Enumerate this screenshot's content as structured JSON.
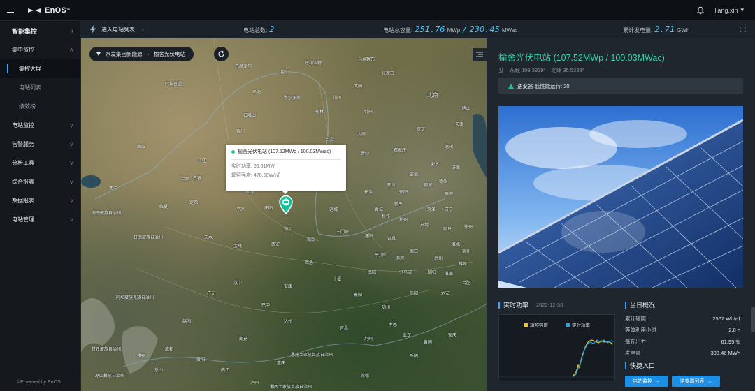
{
  "app": {
    "brand": "EnOS",
    "user": "liang.xin",
    "user_caret": "▾"
  },
  "sidebar": {
    "items": [
      {
        "label": "智能集控",
        "type": "top",
        "chevron": "›"
      },
      {
        "label": "集中监控",
        "type": "group",
        "chevron": "˄"
      },
      {
        "label": "集控大屏",
        "type": "sub-active",
        "chevron": ""
      },
      {
        "label": "电站列表",
        "type": "sub",
        "chevron": ""
      },
      {
        "label": "绩效榜",
        "type": "sub",
        "chevron": ""
      },
      {
        "label": "电站监控",
        "type": "group",
        "chevron": "˅"
      },
      {
        "label": "告警服务",
        "type": "group",
        "chevron": "˅"
      },
      {
        "label": "分析工具",
        "type": "group",
        "chevron": "˅"
      },
      {
        "label": "综合报表",
        "type": "group",
        "chevron": "˅"
      },
      {
        "label": "数据报表",
        "type": "group",
        "chevron": "˅"
      },
      {
        "label": "电站管理",
        "type": "group",
        "chevron": "˅"
      }
    ],
    "powered_by": "©Powered by EnOS"
  },
  "statbar": {
    "enter_label": "进入电站列表",
    "enter_chevron": "›",
    "total_stations_label": "电站总数:",
    "total_stations_value": "2",
    "capacity_label": "电站总容量:",
    "capacity_mwp_value": "251.76",
    "capacity_mwp_unit": "MWp",
    "capacity_sep": "/",
    "capacity_mwac_value": "230.45",
    "capacity_mwac_unit": "MWac",
    "cumulative_label": "累计发电量:",
    "cumulative_value": "2.71",
    "cumulative_unit": "GWh"
  },
  "map": {
    "breadcrumb": {
      "root": "水发集团新能源",
      "separator": "›",
      "current": "榆舍光伏电站"
    },
    "popup": {
      "title": "榆舍光伏电站 (107.52MWp / 100.03MWac)",
      "power_label": "实时功率:",
      "power_value": "66.61MW",
      "irradiance_label": "辐照强度:",
      "irradiance_value": "478.58W/㎡"
    },
    "labels": [
      {
        "t": "巴彦淖尔",
        "c": "ml1"
      },
      {
        "t": "包头",
        "c": "ml2"
      },
      {
        "t": "呼和浩特",
        "c": "ml3"
      },
      {
        "t": "乌兰察布",
        "c": "ml4"
      },
      {
        "t": "张家口",
        "c": "ml5"
      },
      {
        "t": "北京",
        "c": "ml6 big"
      },
      {
        "t": "天津",
        "c": "ml7"
      },
      {
        "t": "唐山",
        "c": "ml8"
      },
      {
        "t": "鄂尔多斯",
        "c": "ml9"
      },
      {
        "t": "乌海",
        "c": "ml10"
      },
      {
        "t": "阿拉善盟",
        "c": "ml11"
      },
      {
        "t": "大同",
        "c": "ml12"
      },
      {
        "t": "朔州",
        "c": "ml13"
      },
      {
        "t": "忻州",
        "c": "ml14"
      },
      {
        "t": "石家庄",
        "c": "ml15"
      },
      {
        "t": "保定",
        "c": "ml16"
      },
      {
        "t": "沧州",
        "c": "ml17"
      },
      {
        "t": "太原",
        "c": "ml18"
      },
      {
        "t": "邢台",
        "c": "ml19"
      },
      {
        "t": "吕梁",
        "c": "ml20"
      },
      {
        "t": "晋中",
        "c": "ml21"
      },
      {
        "t": "长治",
        "c": "ml22"
      },
      {
        "t": "济南",
        "c": "ml23"
      },
      {
        "t": "聊城",
        "c": "ml24"
      },
      {
        "t": "西宁",
        "c": "ml25"
      },
      {
        "t": "兰州",
        "c": "ml26"
      },
      {
        "t": "固原",
        "c": "ml27"
      },
      {
        "t": "平凉",
        "c": "ml28"
      },
      {
        "t": "庆阳",
        "c": "ml29"
      },
      {
        "t": "延安",
        "c": "ml30"
      },
      {
        "t": "铜川",
        "c": "ml31"
      },
      {
        "t": "渭南",
        "c": "ml32"
      },
      {
        "t": "西安",
        "c": "ml33"
      },
      {
        "t": "宝鸡",
        "c": "ml34"
      },
      {
        "t": "天水",
        "c": "ml35"
      },
      {
        "t": "三门峡",
        "c": "ml36"
      },
      {
        "t": "洛阳",
        "c": "ml37"
      },
      {
        "t": "郑州",
        "c": "ml38"
      },
      {
        "t": "开封",
        "c": "ml39"
      },
      {
        "t": "商丘",
        "c": "ml40"
      },
      {
        "t": "徐州",
        "c": "ml41"
      },
      {
        "t": "平顶山",
        "c": "ml42"
      },
      {
        "t": "周口",
        "c": "ml43"
      },
      {
        "t": "南阳",
        "c": "ml44"
      },
      {
        "t": "驻马店",
        "c": "ml45"
      },
      {
        "t": "阜阳",
        "c": "ml46"
      },
      {
        "t": "商洛",
        "c": "ml47"
      },
      {
        "t": "汉中",
        "c": "ml48"
      },
      {
        "t": "安康",
        "c": "ml49"
      },
      {
        "t": "十堰",
        "c": "ml50"
      },
      {
        "t": "襄阳",
        "c": "ml51"
      },
      {
        "t": "随州",
        "c": "ml52"
      },
      {
        "t": "信阳",
        "c": "ml53"
      },
      {
        "t": "六安",
        "c": "ml54"
      },
      {
        "t": "合肥",
        "c": "ml55"
      },
      {
        "t": "广元",
        "c": "ml56"
      },
      {
        "t": "巴中",
        "c": "ml57"
      },
      {
        "t": "达州",
        "c": "ml58"
      },
      {
        "t": "宜昌",
        "c": "ml59"
      },
      {
        "t": "荆州",
        "c": "ml60"
      },
      {
        "t": "孝感",
        "c": "ml61"
      },
      {
        "t": "武汉",
        "c": "ml62"
      },
      {
        "t": "黄冈",
        "c": "ml63"
      },
      {
        "t": "安庆",
        "c": "ml64"
      },
      {
        "t": "绵阳",
        "c": "ml65"
      },
      {
        "t": "成都",
        "c": "ml66"
      },
      {
        "t": "南充",
        "c": "ml67"
      },
      {
        "t": "重庆",
        "c": "ml68"
      },
      {
        "t": "资阳",
        "c": "ml69"
      },
      {
        "t": "乐山",
        "c": "ml70"
      },
      {
        "t": "泸州",
        "c": "ml71"
      },
      {
        "t": "内江",
        "c": "ml72"
      },
      {
        "t": "雅安",
        "c": "ml73"
      },
      {
        "t": "岳阳",
        "c": "ml74"
      },
      {
        "t": "常德",
        "c": "ml75"
      },
      {
        "t": "湘西土家族苗族自治州",
        "c": "ml76"
      },
      {
        "t": "恩施土家族苗族自治州",
        "c": "ml77"
      },
      {
        "t": "海南藏族自治州",
        "c": "ml78"
      },
      {
        "t": "甘南藏族自治州",
        "c": "ml79"
      },
      {
        "t": "阿坝藏族羌族自治州",
        "c": "ml80"
      },
      {
        "t": "甘孜藏族自治州",
        "c": "ml81"
      },
      {
        "t": "凉山彝族自治州",
        "c": "ml82"
      },
      {
        "t": "临夏",
        "c": "ml83"
      },
      {
        "t": "中卫",
        "c": "ml84"
      },
      {
        "t": "吴忠",
        "c": "ml85"
      },
      {
        "t": "银川",
        "c": "ml86"
      },
      {
        "t": "石嘴山",
        "c": "ml87"
      },
      {
        "t": "武威",
        "c": "ml88"
      },
      {
        "t": "白银",
        "c": "ml89"
      },
      {
        "t": "定西",
        "c": "ml90"
      },
      {
        "t": "榆林",
        "c": "ml91"
      },
      {
        "t": "临汾",
        "c": "ml92"
      },
      {
        "t": "运城",
        "c": "ml93"
      },
      {
        "t": "晋城",
        "c": "ml94"
      },
      {
        "t": "焦作",
        "c": "ml95"
      },
      {
        "t": "新乡",
        "c": "ml96"
      },
      {
        "t": "安阳",
        "c": "ml97"
      },
      {
        "t": "邯郸",
        "c": "ml98"
      },
      {
        "t": "衡水",
        "c": "ml99"
      },
      {
        "t": "德州",
        "c": "ml100"
      },
      {
        "t": "泰安",
        "c": "ml101"
      },
      {
        "t": "济宁",
        "c": "ml102"
      },
      {
        "t": "菏泽",
        "c": "ml103"
      },
      {
        "t": "许昌",
        "c": "ml104"
      },
      {
        "t": "漯河",
        "c": "ml105"
      },
      {
        "t": "淮北",
        "c": "ml106"
      },
      {
        "t": "宿州",
        "c": "ml107"
      },
      {
        "t": "蚌埠",
        "c": "ml108"
      },
      {
        "t": "淮南",
        "c": "ml109"
      },
      {
        "t": "亳州",
        "c": "ml110"
      }
    ]
  },
  "panel": {
    "title": "榆舍光伏电站 (107.52MWp / 100.03MWac)",
    "longitude": "东经 109.2929°",
    "latitude": "北纬 35.5333°",
    "alert": "逆变器 低性能运行: 20",
    "realtime": {
      "title": "实时功率",
      "date": "2022-12-30",
      "legend_irradiance": "辐照强度",
      "legend_power": "实时功率"
    },
    "today": {
      "title": "当日概况",
      "rows": [
        {
          "label": "累计辐照",
          "value": "2567 Wh/㎡"
        },
        {
          "label": "等效利用小时",
          "value": "2.8 h"
        },
        {
          "label": "每瓦出力",
          "value": "61.95 %"
        },
        {
          "label": "发电量",
          "value": "303.46 MWh"
        }
      ]
    },
    "quick": {
      "title": "快捷入口",
      "btn_monitor": "电站监控",
      "btn_inverter": "逆变器列表",
      "arrow": "→"
    }
  },
  "colors": {
    "accent": "#34c6ff",
    "green": "#2fd5a8",
    "button": "#1e8fe6",
    "legend_irradiance": "#f5c518",
    "legend_power": "#1ea7f5"
  }
}
